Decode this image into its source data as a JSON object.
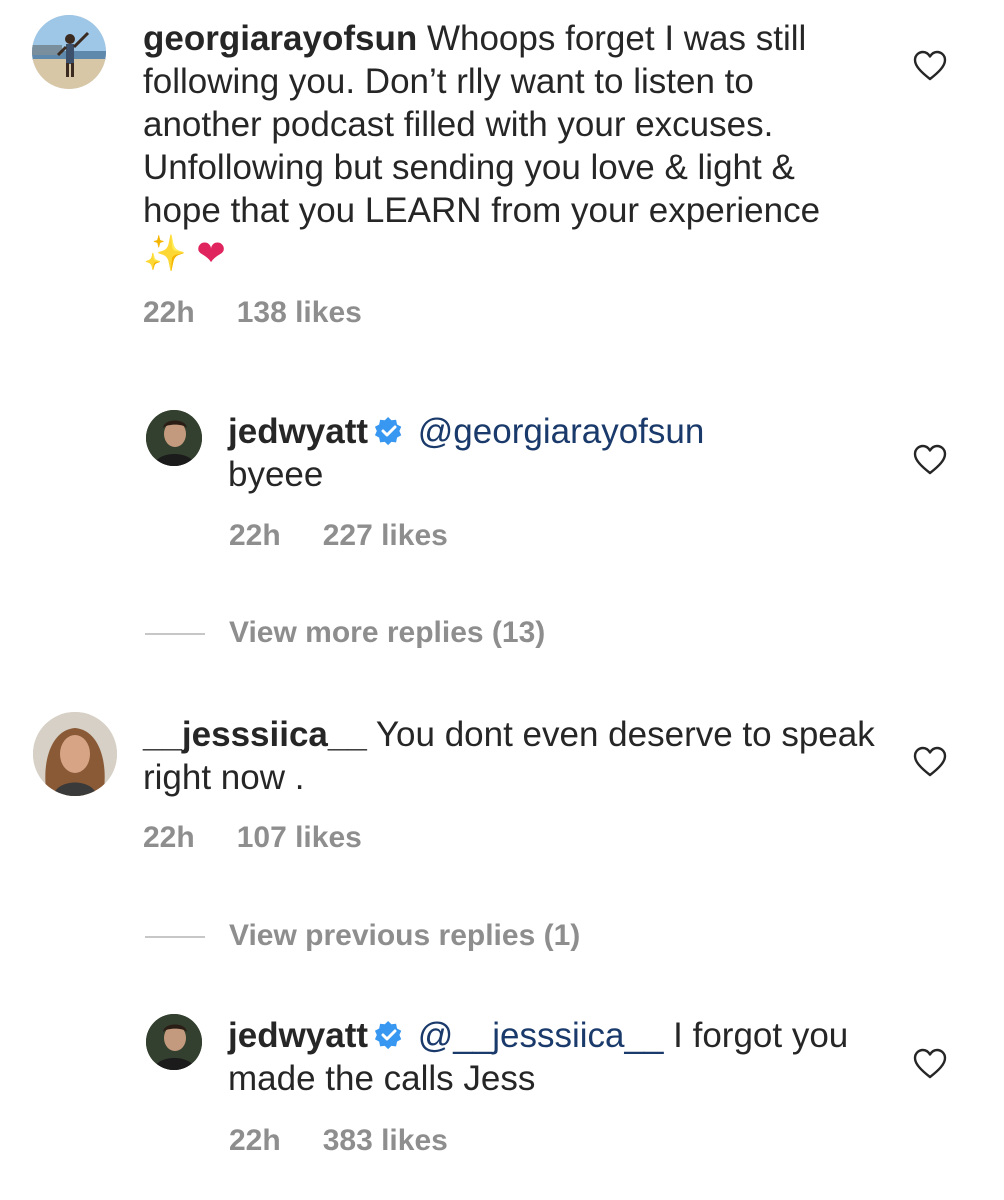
{
  "comments": [
    {
      "username": "georgiarayofsun",
      "text": "Whoops forget I was still following you. Don’t rlly want to listen to another podcast filled with your excuses. Unfollowing but sending you love & light & hope that you LEARN from your experience",
      "emoji_sparkles": "✨",
      "emoji_heart": "❤",
      "time": "22h",
      "likes": "138 likes"
    },
    {
      "username": "jedwyatt",
      "verified": true,
      "mention": "@georgiarayofsun",
      "text": "byeee",
      "time": "22h",
      "likes": "227 likes"
    },
    {
      "username": "__jesssiica__",
      "text": "You dont even deserve to speak right now .",
      "time": "22h",
      "likes": "107 likes"
    },
    {
      "username": "jedwyatt",
      "verified": true,
      "mention": "@__jesssiica__",
      "text": "I forgot you made the calls Jess",
      "time": "22h",
      "likes": "383 likes"
    }
  ],
  "replies_links": {
    "more": "View more replies (13)",
    "previous": "View previous replies (1)"
  },
  "icons": {
    "heart": "heart-outline-icon",
    "verified": "verified-badge-icon"
  },
  "colors": {
    "text": "#262626",
    "meta": "#8e8e8e",
    "mention": "#1a3a6b",
    "verified": "#3897f0"
  }
}
